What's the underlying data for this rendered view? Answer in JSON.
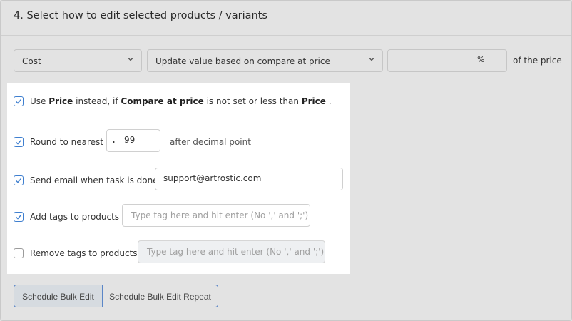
{
  "section": {
    "title": "4. Select how to edit selected products / variants"
  },
  "field_select": {
    "value": "Cost"
  },
  "method_select": {
    "value": "Update value based on compare at price"
  },
  "value_input": {
    "unit": "%",
    "suffix": "of the price"
  },
  "options": {
    "use_price": {
      "checked": true,
      "parts": [
        "Use ",
        "Price",
        " instead, if ",
        "Compare at price",
        " is not set or less than ",
        "Price",
        " ."
      ]
    },
    "round": {
      "checked": true,
      "label": "Round to nearest",
      "prefix": ".",
      "value": "99",
      "suffix": "after decimal point"
    },
    "email": {
      "checked": true,
      "label": "Send email when task is done",
      "value": "support@artrostic.com"
    },
    "add_tags": {
      "checked": true,
      "label": "Add tags to products",
      "placeholder": "Type tag here and hit enter (No ',' and ';')"
    },
    "remove_tags": {
      "checked": false,
      "label": "Remove tags to products",
      "placeholder": "Type tag here and hit enter (No ',' and ';')"
    }
  },
  "buttons": {
    "schedule": "Schedule Bulk Edit",
    "schedule_repeat": "Schedule Bulk Edit Repeat"
  },
  "colors": {
    "accent": "#3f7fcf",
    "panel": "#ffffff",
    "background": "#e3e3e3"
  }
}
